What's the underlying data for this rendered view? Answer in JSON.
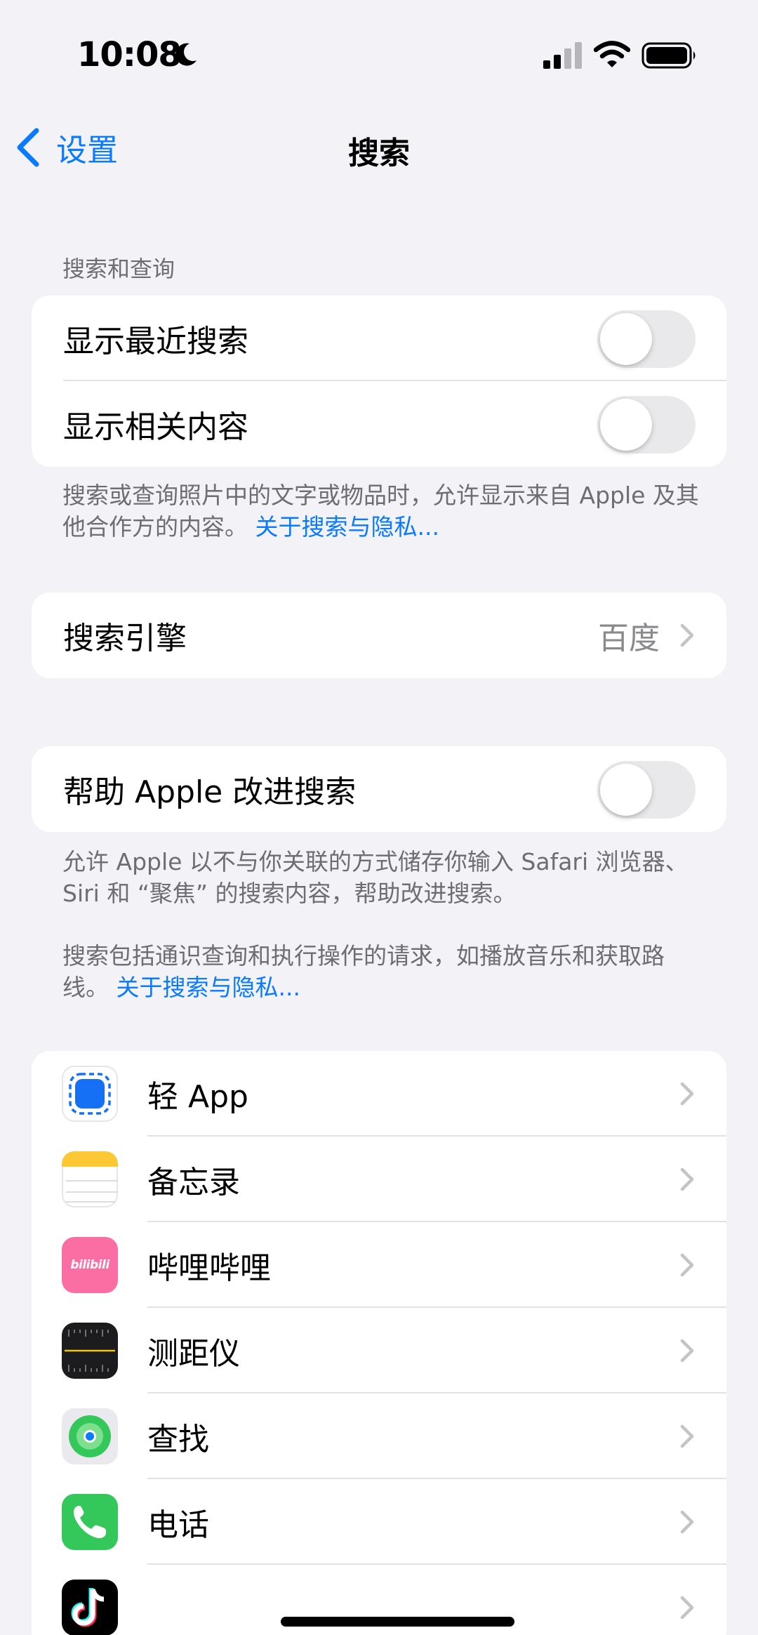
{
  "status_bar": {
    "time": "10:08"
  },
  "nav": {
    "back_label": "设置",
    "title": "搜索"
  },
  "search_section": {
    "header": "搜索和查询",
    "rows": [
      {
        "label": "显示最近搜索",
        "toggle_on": false
      },
      {
        "label": "显示相关内容",
        "toggle_on": false
      }
    ],
    "footer_text": "搜索或查询照片中的文字或物品时，允许显示来自 Apple 及其他合作方的内容。",
    "footer_link": "关于搜索与隐私..."
  },
  "engine_section": {
    "label": "搜索引擎",
    "value": "百度"
  },
  "improve_section": {
    "label": "帮助 Apple 改进搜索",
    "toggle_on": false,
    "footer_text_1": "允许 Apple 以不与你关联的方式储存你输入 Safari 浏览器、Siri 和 “聚焦” 的搜索内容，帮助改进搜索。",
    "footer_text_2": "搜索包括通识查询和执行操作的请求，如播放音乐和获取路线。",
    "footer_link": "关于搜索与隐私..."
  },
  "apps": [
    {
      "label": "轻 App",
      "icon": "app-clip-icon"
    },
    {
      "label": "备忘录",
      "icon": "notes-icon"
    },
    {
      "label": "哔哩哔哩",
      "icon": "bilibili-icon",
      "icon_text": "bilibili"
    },
    {
      "label": "测距仪",
      "icon": "measure-icon"
    },
    {
      "label": "查找",
      "icon": "find-my-icon"
    },
    {
      "label": "电话",
      "icon": "phone-icon"
    },
    {
      "label": "",
      "icon": "tiktok-icon"
    }
  ],
  "colors": {
    "accent": "#0a7aff",
    "background": "#f2f2f7",
    "secondary_text": "#6d6d72"
  }
}
